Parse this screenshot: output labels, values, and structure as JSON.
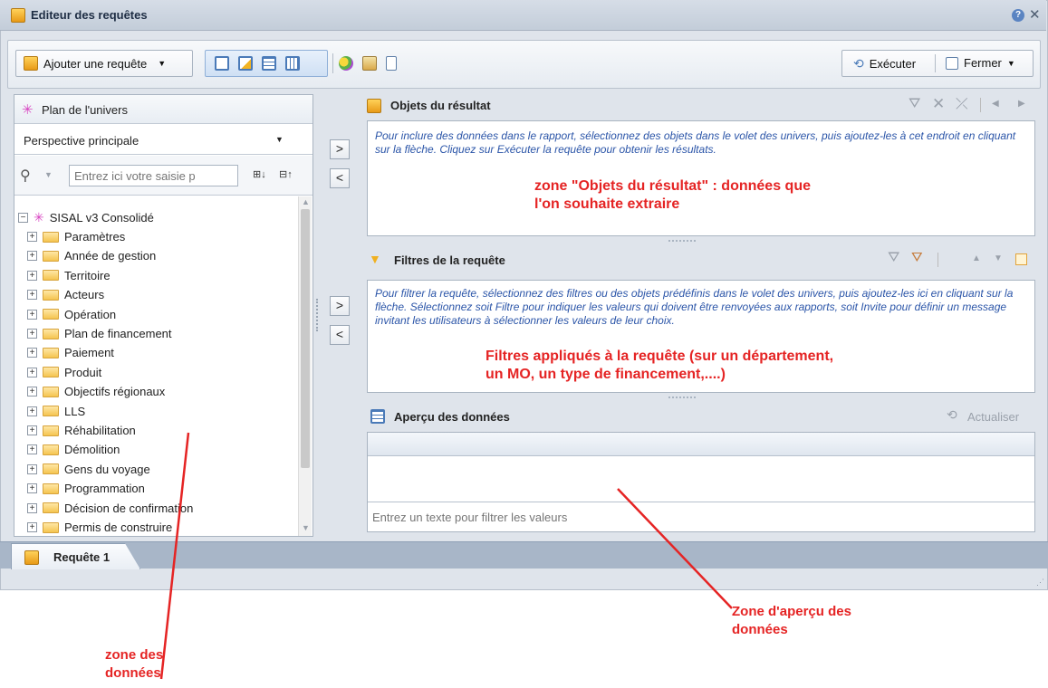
{
  "window": {
    "title": "Editeur des requêtes"
  },
  "toolbar": {
    "add_query_label": "Ajouter une requête",
    "run_label": "Exécuter",
    "close_label": "Fermer"
  },
  "universe": {
    "header": "Plan de l'univers",
    "perspective": "Perspective principale",
    "search_placeholder": "Entrez ici votre saisie p",
    "root": "SISAL v3 Consolidé",
    "items": [
      "Paramètres",
      "Année de gestion",
      "Territoire",
      "Acteurs",
      "Opération",
      "Plan de financement",
      "Paiement",
      "Produit",
      "Objectifs régionaux",
      "LLS",
      "Réhabilitation",
      "Démolition",
      "Gens du voyage",
      "Programmation",
      "Décision de confirmation",
      "Permis de construire"
    ]
  },
  "arrows": {
    "add": ">",
    "remove": "<"
  },
  "results": {
    "title": "Objets du résultat",
    "hint": "Pour inclure des données dans le rapport, sélectionnez des objets dans le volet des univers, puis ajoutez-les à cet endroit en cliquant sur la flèche. Cliquez sur Exécuter la requête pour obtenir les résultats.",
    "annotation_line1": "zone \"Objets du résultat\" : données que",
    "annotation_line2": "l'on souhaite extraire"
  },
  "filters": {
    "title": "Filtres de la requête",
    "hint": "Pour filtrer la requête, sélectionnez des filtres ou des objets prédéfinis dans le volet des univers, puis ajoutez-les ici en cliquant sur la flèche. Sélectionnez soit Filtre pour indiquer les valeurs qui doivent être renvoyées aux rapports, soit Invite pour définir un message invitant les utilisateurs à sélectionner les valeurs de leur choix.",
    "annotation_line1": "Filtres appliqués à la requête (sur un département,",
    "annotation_line2": "un MO, un type de financement,....)"
  },
  "preview": {
    "title": "Aperçu des données",
    "refresh_label": "Actualiser",
    "filter_placeholder": "Entrez un texte pour filtrer les valeurs"
  },
  "tabs": [
    {
      "label": "Requête 1"
    }
  ],
  "annotations": {
    "preview_zone_line1": "Zone d'aperçu des",
    "preview_zone_line2": "données",
    "data_zone_line1": "zone des",
    "data_zone_line2": "données"
  },
  "colors": {
    "annotation": "#e52424",
    "hint": "#2b55a8",
    "accent": "#4a7ab8"
  }
}
